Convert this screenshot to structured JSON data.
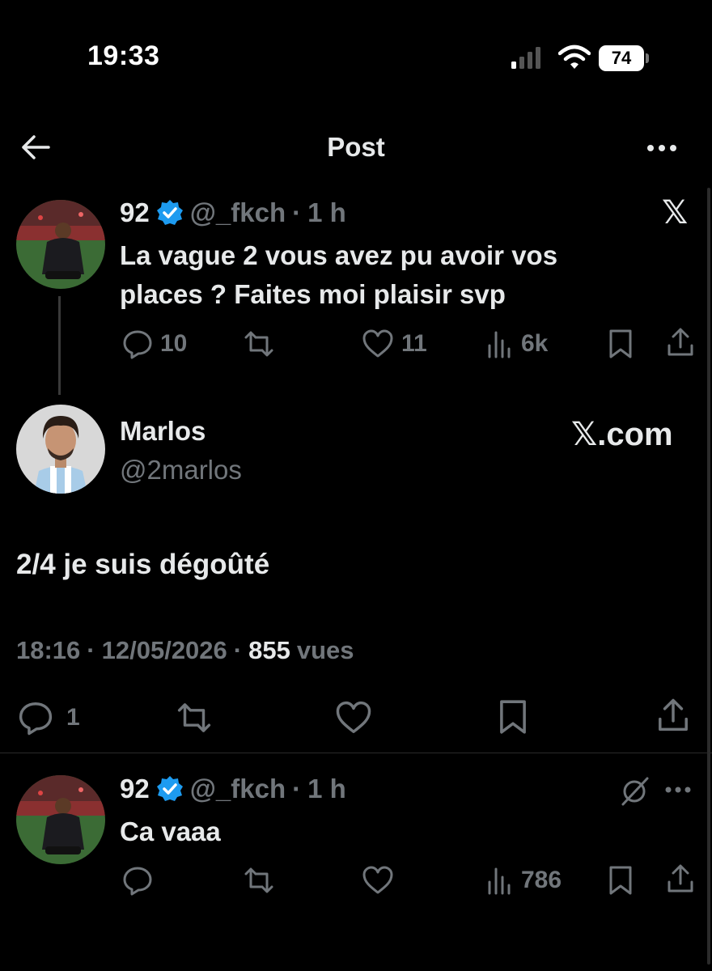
{
  "status_bar": {
    "time": "19:33",
    "battery": "74"
  },
  "header": {
    "title": "Post"
  },
  "parent_tweet": {
    "display_name": "92",
    "handle": "@_fkch",
    "separator": "·",
    "time": "1 h",
    "text_line1": "La vague 2 vous avez pu avoir vos",
    "text_line2": "places ? Faites moi plaisir svp",
    "replies": "10",
    "likes": "11",
    "views": "6k",
    "x_badge": "𝕏"
  },
  "main_tweet": {
    "display_name": "Marlos",
    "handle": "@2marlos",
    "source": "𝕏.com",
    "text": "2/4 je suis dégoûté",
    "time": "18:16",
    "sep1": "·",
    "date": "12/05/2026",
    "sep2": "·",
    "views_count": "855",
    "views_label": "vues",
    "replies": "1"
  },
  "reply_tweet": {
    "display_name": "92",
    "handle": "@_fkch",
    "separator": "·",
    "time": "1 h",
    "text": "Ca vaaa",
    "views": "786"
  },
  "colors": {
    "verified": "#1d9bf0",
    "muted": "#71767b",
    "text": "#e7e9ea",
    "background": "#000000"
  }
}
